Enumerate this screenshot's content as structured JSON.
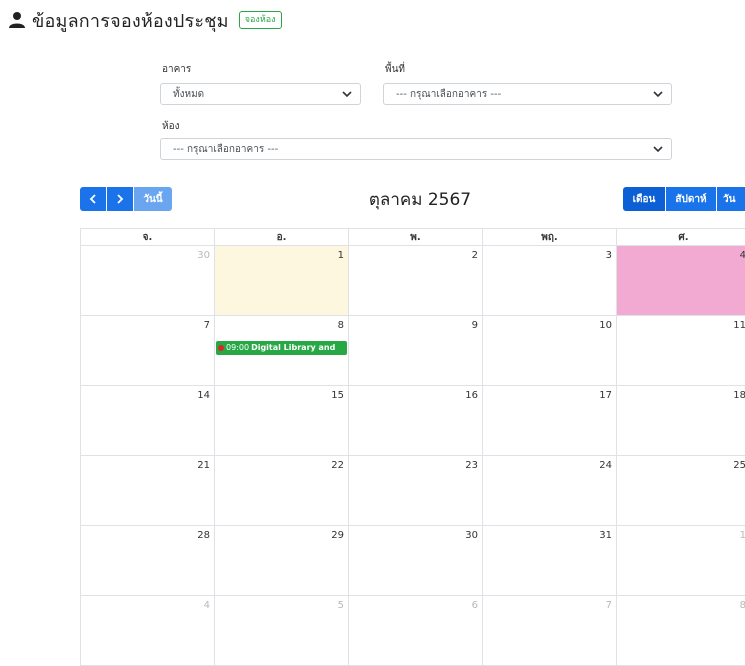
{
  "header": {
    "title": "ข้อมูลการจองห้องประชุม",
    "book_label": "จองห้อง"
  },
  "filters": {
    "building_label": "อาคาร",
    "building_value": "ทั้งหมด",
    "area_label": "พื้นที่",
    "area_value": "--- กรุณาเลือกอาคาร ---",
    "room_label": "ห้อง",
    "room_value": "--- กรุณาเลือกอาคาร ---"
  },
  "toolbar": {
    "today_label": "วันนี้",
    "title": "ตุลาคม 2567",
    "views": [
      "เดือน",
      "สัปดาห์",
      "วัน"
    ]
  },
  "calendar": {
    "weekdays": [
      "จ.",
      "อ.",
      "พ.",
      "พฤ.",
      "ศ."
    ],
    "weeks": [
      [
        {
          "d": "30",
          "other": true
        },
        {
          "d": "1",
          "today": true
        },
        {
          "d": "2"
        },
        {
          "d": "3"
        },
        {
          "d": "4",
          "highlight": true
        }
      ],
      [
        {
          "d": "7"
        },
        {
          "d": "8",
          "event": {
            "time": "09:00",
            "title": "Digital Library and"
          }
        },
        {
          "d": "9"
        },
        {
          "d": "10"
        },
        {
          "d": "11"
        }
      ],
      [
        {
          "d": "14"
        },
        {
          "d": "15"
        },
        {
          "d": "16"
        },
        {
          "d": "17"
        },
        {
          "d": "18"
        }
      ],
      [
        {
          "d": "21"
        },
        {
          "d": "22"
        },
        {
          "d": "23"
        },
        {
          "d": "24"
        },
        {
          "d": "25"
        }
      ],
      [
        {
          "d": "28"
        },
        {
          "d": "29"
        },
        {
          "d": "30"
        },
        {
          "d": "31"
        },
        {
          "d": "1",
          "other": true
        }
      ],
      [
        {
          "d": "4",
          "other": true
        },
        {
          "d": "5",
          "other": true
        },
        {
          "d": "6",
          "other": true
        },
        {
          "d": "7",
          "other": true
        },
        {
          "d": "8",
          "other": true
        }
      ]
    ]
  },
  "colors": {
    "primary": "#1a73e8",
    "success": "#28a745",
    "today_bg": "#fdf7df",
    "highlight_bg": "#f2a9d2"
  }
}
